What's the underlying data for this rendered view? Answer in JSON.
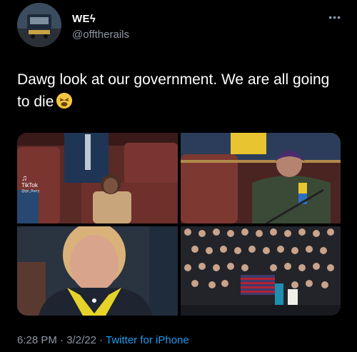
{
  "author": {
    "display_name": "WEϟ",
    "handle": "@offtherails"
  },
  "more_label": "•••",
  "tweet": {
    "text": "Dawg look at our government. We are all going to die"
  },
  "media": {
    "watermark_brand": "TikTok",
    "watermark_user": "@gn_Borry",
    "flag_colors": {
      "stripe_red": "#b22234",
      "canton_blue": "#3c3b6e"
    }
  },
  "footer": {
    "time": "6:28 PM",
    "separator": " · ",
    "date": "3/2/22",
    "source": "Twitter for iPhone"
  },
  "colors": {
    "background": "#000000",
    "secondary_text": "#8b98a5",
    "link": "#1d9bf0"
  }
}
